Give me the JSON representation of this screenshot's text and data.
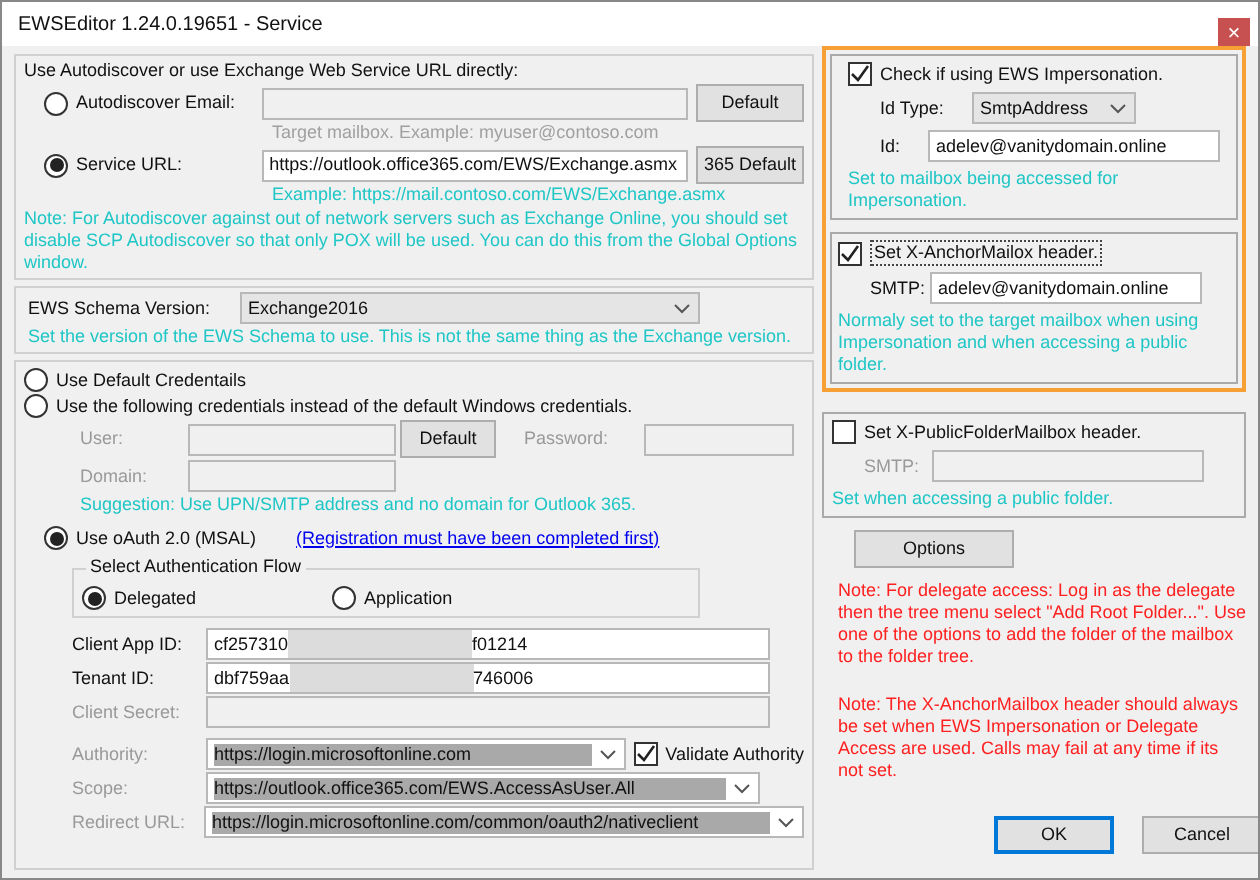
{
  "window": {
    "title": "EWSEditor 1.24.0.19651 - Service",
    "close": "×"
  },
  "connection": {
    "heading": "Use Autodiscover or use Exchange Web Service URL directly:",
    "options": [
      {
        "label": "Autodiscover Email:",
        "selected": false,
        "disabled": true,
        "button": "Default",
        "hint": "Target mailbox.  Example: myuser@contoso.com"
      },
      {
        "label": "Service URL:",
        "selected": true,
        "value": "https://outlook.office365.com/EWS/Exchange.asmx",
        "disabled": false,
        "button": "365 Default",
        "hint": "Example: https://mail.contoso.com/EWS/Exchange.asmx"
      }
    ],
    "note": "Note: For Autodiscover against out of network servers such as Exchange Online, you should set disable SCP Autodiscover so that only POX will be used.  You can do this from the Global Options window."
  },
  "schema": {
    "label": "EWS Schema Version:",
    "value": "Exchange2016",
    "note": "Set the version of the EWS Schema to use.  This is not the same thing as the Exchange version."
  },
  "credentials": {
    "options": [
      {
        "label": "Use Default Credentails",
        "selected": false
      },
      {
        "label": "Use the following credentials instead of the default Windows credentials.",
        "selected": false
      }
    ],
    "user_label": "User:",
    "domain_label": "Domain:",
    "password_label": "Password:",
    "default_button": "Default",
    "suggestion": "Suggestion: Use UPN/SMTP address and no domain for Outlook 365.",
    "oauth": {
      "label": "Use oAuth 2.0 (MSAL)",
      "selected": true,
      "link": "(Registration must have been completed first)",
      "flow_title": "Select Authentication Flow",
      "flows": [
        {
          "label": "Delegated",
          "selected": true
        },
        {
          "label": "Application",
          "selected": false
        }
      ],
      "client_app_id": {
        "label": "Client App ID:",
        "start": "cf257310",
        "end": "f01214"
      },
      "tenant_id": {
        "label": "Tenant ID:",
        "start": "dbf759aa",
        "end": "746006"
      },
      "client_secret": {
        "label": "Client Secret:"
      },
      "authority": {
        "label": "Authority:",
        "value": "https://login.microsoftonline.com",
        "validate_label": "Validate Authority",
        "validate_checked": true
      },
      "scope": {
        "label": "Scope:",
        "value": "https://outlook.office365.com/EWS.AccessAsUser.All"
      },
      "redirect": {
        "label": "Redirect URL:",
        "value": "https://login.microsoftonline.com/common/oauth2/nativeclient"
      }
    }
  },
  "impersonation": {
    "label": "Check if using EWS Impersonation.",
    "checked": true,
    "id_type_label": "Id Type:",
    "id_type": "SmtpAddress",
    "id_label": "Id:",
    "id": "adelev@vanitydomain.online",
    "note": "Set to mailbox being accessed for Impersonation."
  },
  "anchor": {
    "label": "Set X-AnchorMailox header.",
    "checked": true,
    "smtp_label": "SMTP:",
    "smtp": "adelev@vanitydomain.online",
    "note": "Normaly set to the target mailbox when using Impersonation and when accessing a public folder."
  },
  "public_folder": {
    "label": "Set X-PublicFolderMailbox header.",
    "checked": false,
    "smtp_label": "SMTP:",
    "note": "Set when accessing a public folder."
  },
  "options_button": "Options",
  "notes": [
    "Note: For delegate access: Log in as the delegate then the tree menu select \"Add Root Folder...\".  Use one of the options to add the folder of the mailbox to the folder tree.",
    "Note: The X-AnchorMailbox header should always be set when EWS Impersonation or Delegate Access are used.  Calls may fail at any time if its not set."
  ],
  "buttons": [
    {
      "label": "OK",
      "default": true
    },
    {
      "label": "Cancel",
      "default": false
    }
  ]
}
